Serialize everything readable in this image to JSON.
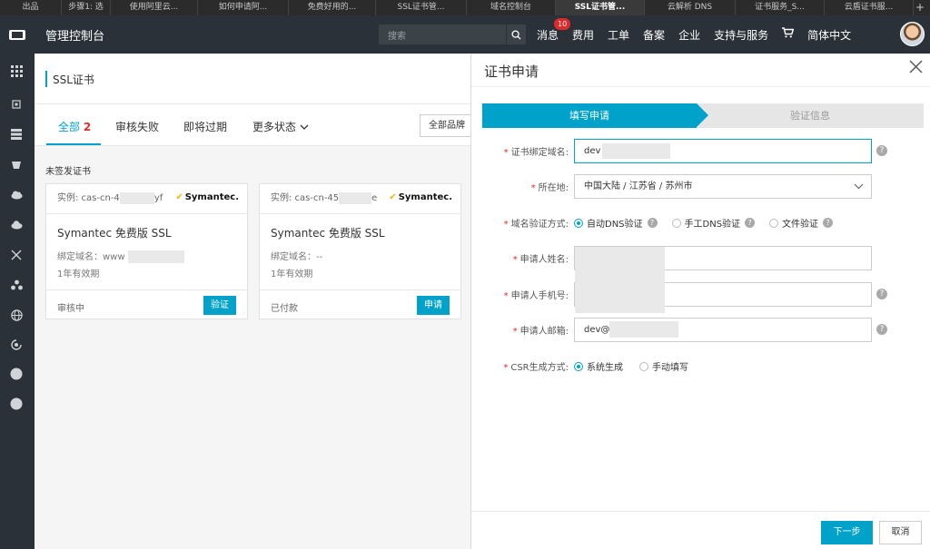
{
  "browser_tabs": [
    {
      "label": "出品"
    },
    {
      "label": "步骤1: 选"
    },
    {
      "label": "使用阿里云..."
    },
    {
      "label": "如何申请阿..."
    },
    {
      "label": "免费好用的..."
    },
    {
      "label": "SSL证书管..."
    },
    {
      "label": "域名控制台"
    },
    {
      "label": "SSL证书管..."
    },
    {
      "label": "云解析 DNS"
    },
    {
      "label": "证书服务_S..."
    },
    {
      "label": "云盾证书服..."
    }
  ],
  "topbar": {
    "console_title": "管理控制台",
    "search_placeholder": "搜索",
    "nav": {
      "messages": "消息",
      "messages_badge": "10",
      "billing": "费用",
      "tickets": "工单",
      "icp": "备案",
      "enterprise": "企业",
      "support": "支持与服务",
      "language": "简体中文"
    }
  },
  "page": {
    "title": "SSL证书",
    "tabs": {
      "all": "全部",
      "all_count": "2",
      "failed": "审核失败",
      "expiring": "即将过期",
      "more": "更多状态"
    },
    "brand_filter": "全部品牌",
    "section_label": "未签发证书"
  },
  "cards": [
    {
      "instance": "实例: cas-cn-4",
      "instance_tail": "yf",
      "brand": "Symantec.",
      "name": "Symantec 免费版 SSL",
      "domain_label": "绑定域名：",
      "domain_value": "www",
      "validity": "1年有效期",
      "status": "审核中",
      "action": "验证"
    },
    {
      "instance": "实例: cas-cn-45",
      "instance_tail": "e",
      "brand": "Symantec.",
      "name": "Symantec 免费版 SSL",
      "domain_label": "绑定域名：",
      "domain_value": "--",
      "validity": "1年有效期",
      "status": "已付款",
      "action": "申请"
    }
  ],
  "dialog": {
    "title": "证书申请",
    "steps": {
      "step1": "填写申请",
      "step2": "验证信息"
    },
    "fields": {
      "domain_label": "证书绑定域名:",
      "domain_value": "dev",
      "region_label": "所在地:",
      "region_value": "中国大陆 / 江苏省 / 苏州市",
      "verify_label": "域名验证方式:",
      "verify_options": {
        "auto_dns": "自动DNS验证",
        "manual_dns": "手工DNS验证",
        "file": "文件验证"
      },
      "name_label": "申请人姓名:",
      "phone_label": "申请人手机号:",
      "email_label": "申请人邮箱:",
      "email_value": "dev@",
      "csr_label": "CSR生成方式:",
      "csr_options": {
        "system": "系统生成",
        "manual": "手动填写"
      }
    },
    "footer": {
      "next": "下一步",
      "cancel": "取消"
    }
  },
  "colors": {
    "accent": "#00a2ca",
    "topbar": "#2b3138",
    "badge": "#e02a2a"
  }
}
